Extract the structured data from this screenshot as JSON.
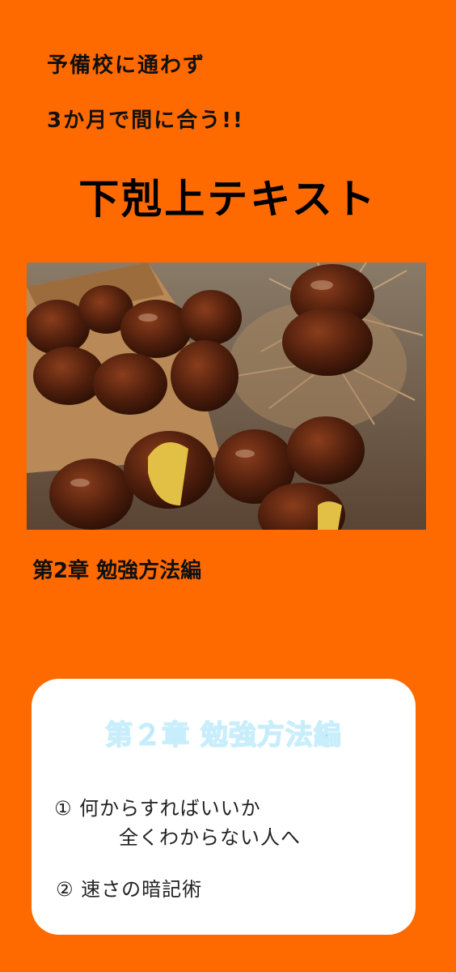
{
  "header": {
    "tagline_line1": "予備校に通わず",
    "tagline_line2": "3か月で間に合う!!",
    "title": "下剋上テキスト"
  },
  "hero_image": {
    "subject": "chestnuts-photo"
  },
  "chapter_label": "第2章  勉強方法編",
  "card": {
    "title": "第２章 勉強方法編",
    "items": [
      {
        "line1": "① 何からすればいいか",
        "line2": "全くわからない人へ"
      },
      {
        "line1": "② 速さの暗記術"
      }
    ]
  },
  "colors": {
    "background": "#ff6a00",
    "card_title": "#7fd2f0",
    "text": "#111111"
  }
}
